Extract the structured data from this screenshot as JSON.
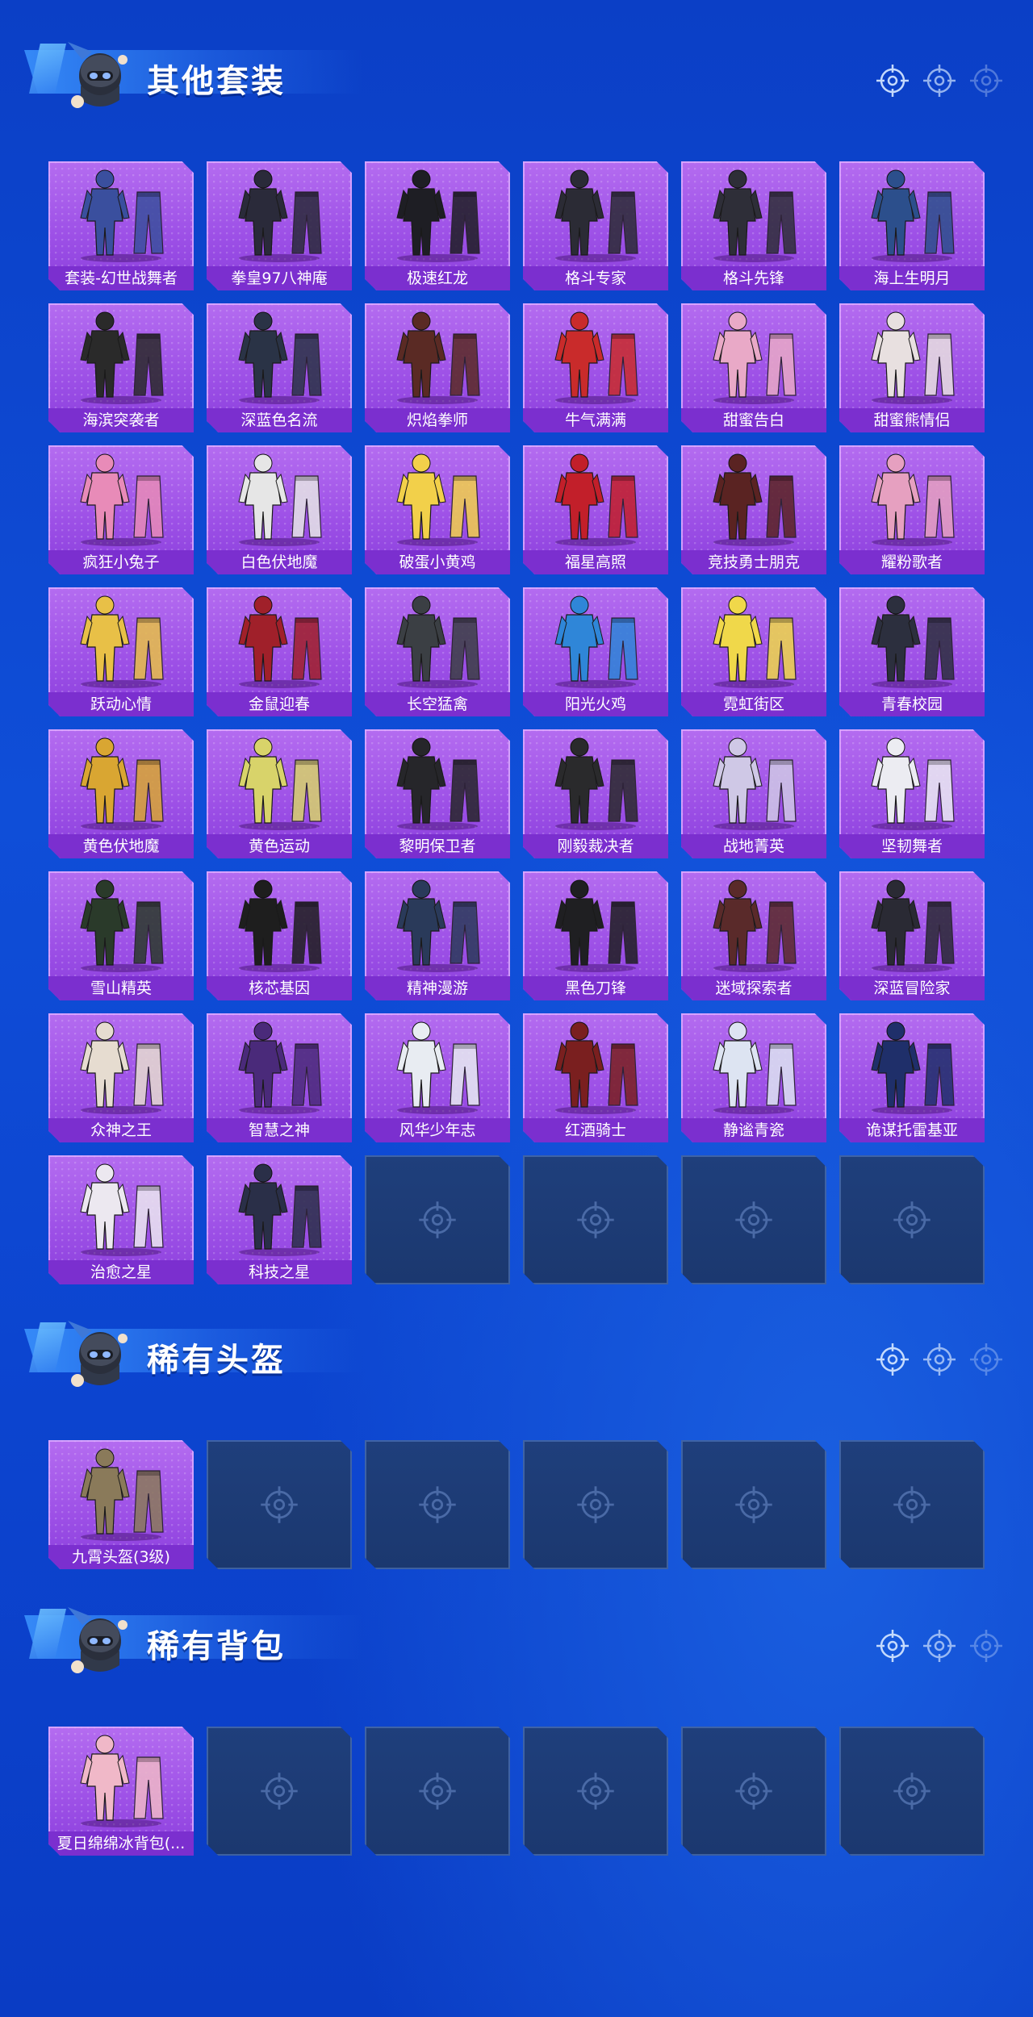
{
  "sections": [
    {
      "title": "其他套装",
      "items": [
        {
          "name": "套装-幻世战舞者",
          "color": "#3a4f9e"
        },
        {
          "name": "拳皇97八神庵",
          "color": "#2a2a3a"
        },
        {
          "name": "极速红龙",
          "color": "#1e1e24"
        },
        {
          "name": "格斗专家",
          "color": "#2b2b35"
        },
        {
          "name": "格斗先锋",
          "color": "#2e2e38"
        },
        {
          "name": "海上生明月",
          "color": "#2c4f8c"
        },
        {
          "name": "海滨突袭者",
          "color": "#2a2a2a"
        },
        {
          "name": "深蓝色名流",
          "color": "#2a3346"
        },
        {
          "name": "炽焰拳师",
          "color": "#5a2a24"
        },
        {
          "name": "牛气满满",
          "color": "#c92b2b"
        },
        {
          "name": "甜蜜告白",
          "color": "#e9a9c7"
        },
        {
          "name": "甜蜜熊情侣",
          "color": "#e8e0e0"
        },
        {
          "name": "疯狂小兔子",
          "color": "#e88bb8"
        },
        {
          "name": "白色伏地魔",
          "color": "#e6e6e6"
        },
        {
          "name": "破蛋小黄鸡",
          "color": "#f2d04a"
        },
        {
          "name": "福星高照",
          "color": "#c21f2a"
        },
        {
          "name": "竞技勇士朋克",
          "color": "#5a2322"
        },
        {
          "name": "耀粉歌者",
          "color": "#e6a0c0"
        },
        {
          "name": "跃动心情",
          "color": "#e8c047"
        },
        {
          "name": "金鼠迎春",
          "color": "#a0202a"
        },
        {
          "name": "长空猛禽",
          "color": "#3b3f44"
        },
        {
          "name": "阳光火鸡",
          "color": "#2f86d8"
        },
        {
          "name": "霓虹街区",
          "color": "#f0d84a"
        },
        {
          "name": "青春校园",
          "color": "#2c2f3e"
        },
        {
          "name": "黄色伏地魔",
          "color": "#d9a632"
        },
        {
          "name": "黄色运动",
          "color": "#d8d36a"
        },
        {
          "name": "黎明保卫者",
          "color": "#26262a"
        },
        {
          "name": "刚毅裁决者",
          "color": "#2a2a2c"
        },
        {
          "name": "战地菁英",
          "color": "#cfc8e6"
        },
        {
          "name": "坚韧舞者",
          "color": "#ececf2"
        },
        {
          "name": "雪山精英",
          "color": "#2a3a2a"
        },
        {
          "name": "核芯基因",
          "color": "#1e1e1e"
        },
        {
          "name": "精神漫游",
          "color": "#2a3a5a"
        },
        {
          "name": "黑色刀锋",
          "color": "#1f1f22"
        },
        {
          "name": "迷域探索者",
          "color": "#5a2a2a"
        },
        {
          "name": "深蓝冒险家",
          "color": "#2a2a34"
        },
        {
          "name": "众神之王",
          "color": "#e6dcd0"
        },
        {
          "name": "智慧之神",
          "color": "#4a2a7a"
        },
        {
          "name": "风华少年志",
          "color": "#e8ecf2"
        },
        {
          "name": "红酒骑士",
          "color": "#7a1f1f"
        },
        {
          "name": "静谧青瓷",
          "color": "#dde4f2"
        },
        {
          "name": "诡谋托雷基亚",
          "color": "#1f2f6a"
        },
        {
          "name": "治愈之星",
          "color": "#ece8f0"
        },
        {
          "name": "科技之星",
          "color": "#2a2f48"
        }
      ],
      "total_slots": 48
    },
    {
      "title": "稀有头盔",
      "items": [
        {
          "name": "九霄头盔(3级)",
          "color": "#8a7a5a"
        }
      ],
      "total_slots": 6
    },
    {
      "title": "稀有背包",
      "items": [
        {
          "name": "夏日绵绵冰背包(...",
          "color": "#f0b8c8"
        }
      ],
      "total_slots": 6
    }
  ],
  "theme": {
    "card_bg": "#9c4fe6",
    "label_bg": "#7b2fcf",
    "empty_bg": "#1f3f7c",
    "page_bg": "#0f4ed8"
  },
  "icons": {
    "header_mascot": "helmet-mascot-icon",
    "header_reticle": "crosshair-icon",
    "empty_slot": "crosshair-icon"
  }
}
